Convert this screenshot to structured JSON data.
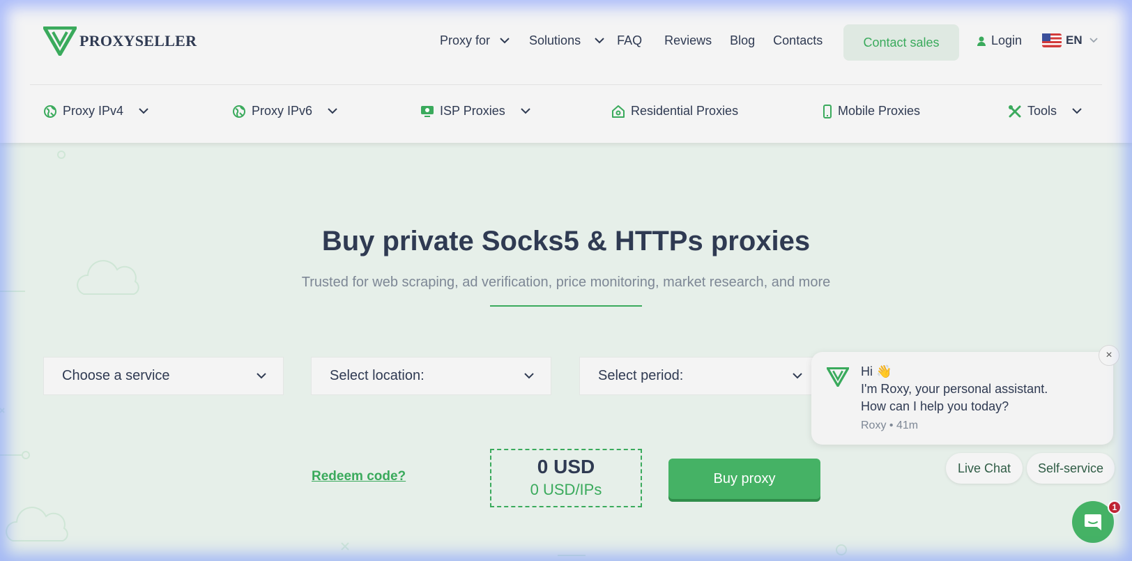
{
  "header": {
    "logo_text": "PROXYSELLER",
    "nav": {
      "proxy_for": "Proxy for",
      "solutions": "Solutions",
      "faq": "FAQ",
      "reviews": "Reviews",
      "blog": "Blog",
      "contacts": "Contacts"
    },
    "contact_sales": "Contact sales",
    "login": "Login",
    "language": "EN"
  },
  "subnav": {
    "ipv4": "Proxy IPv4",
    "ipv6": "Proxy IPv6",
    "isp": "ISP Proxies",
    "residential": "Residential Proxies",
    "mobile": "Mobile Proxies",
    "tools": "Tools"
  },
  "hero": {
    "title": "Buy private Socks5 & HTTPs proxies",
    "subtitle": "Trusted for web scraping, ad verification, price monitoring, market research, and more"
  },
  "order": {
    "service_placeholder": "Choose a service",
    "location_placeholder": "Select location:",
    "period_placeholder": "Select period:",
    "redeem": "Redeem code?",
    "total": "0 USD",
    "per_ip": "0 USD/IPs",
    "buy": "Buy proxy"
  },
  "chat": {
    "greeting": "Hi 👋",
    "line1": "I'm Roxy, your personal assistant.",
    "line2": "How can I help you today?",
    "meta": "Roxy • 41m",
    "close": "×",
    "live_chat": "Live Chat",
    "self_service": "Self-service",
    "unread_count": "1"
  },
  "colors": {
    "brand_green": "#3aaa5c",
    "text_dark": "#2f3a52",
    "header_bg": "#f4f4f4",
    "hero_bg": "#e6efe9"
  }
}
